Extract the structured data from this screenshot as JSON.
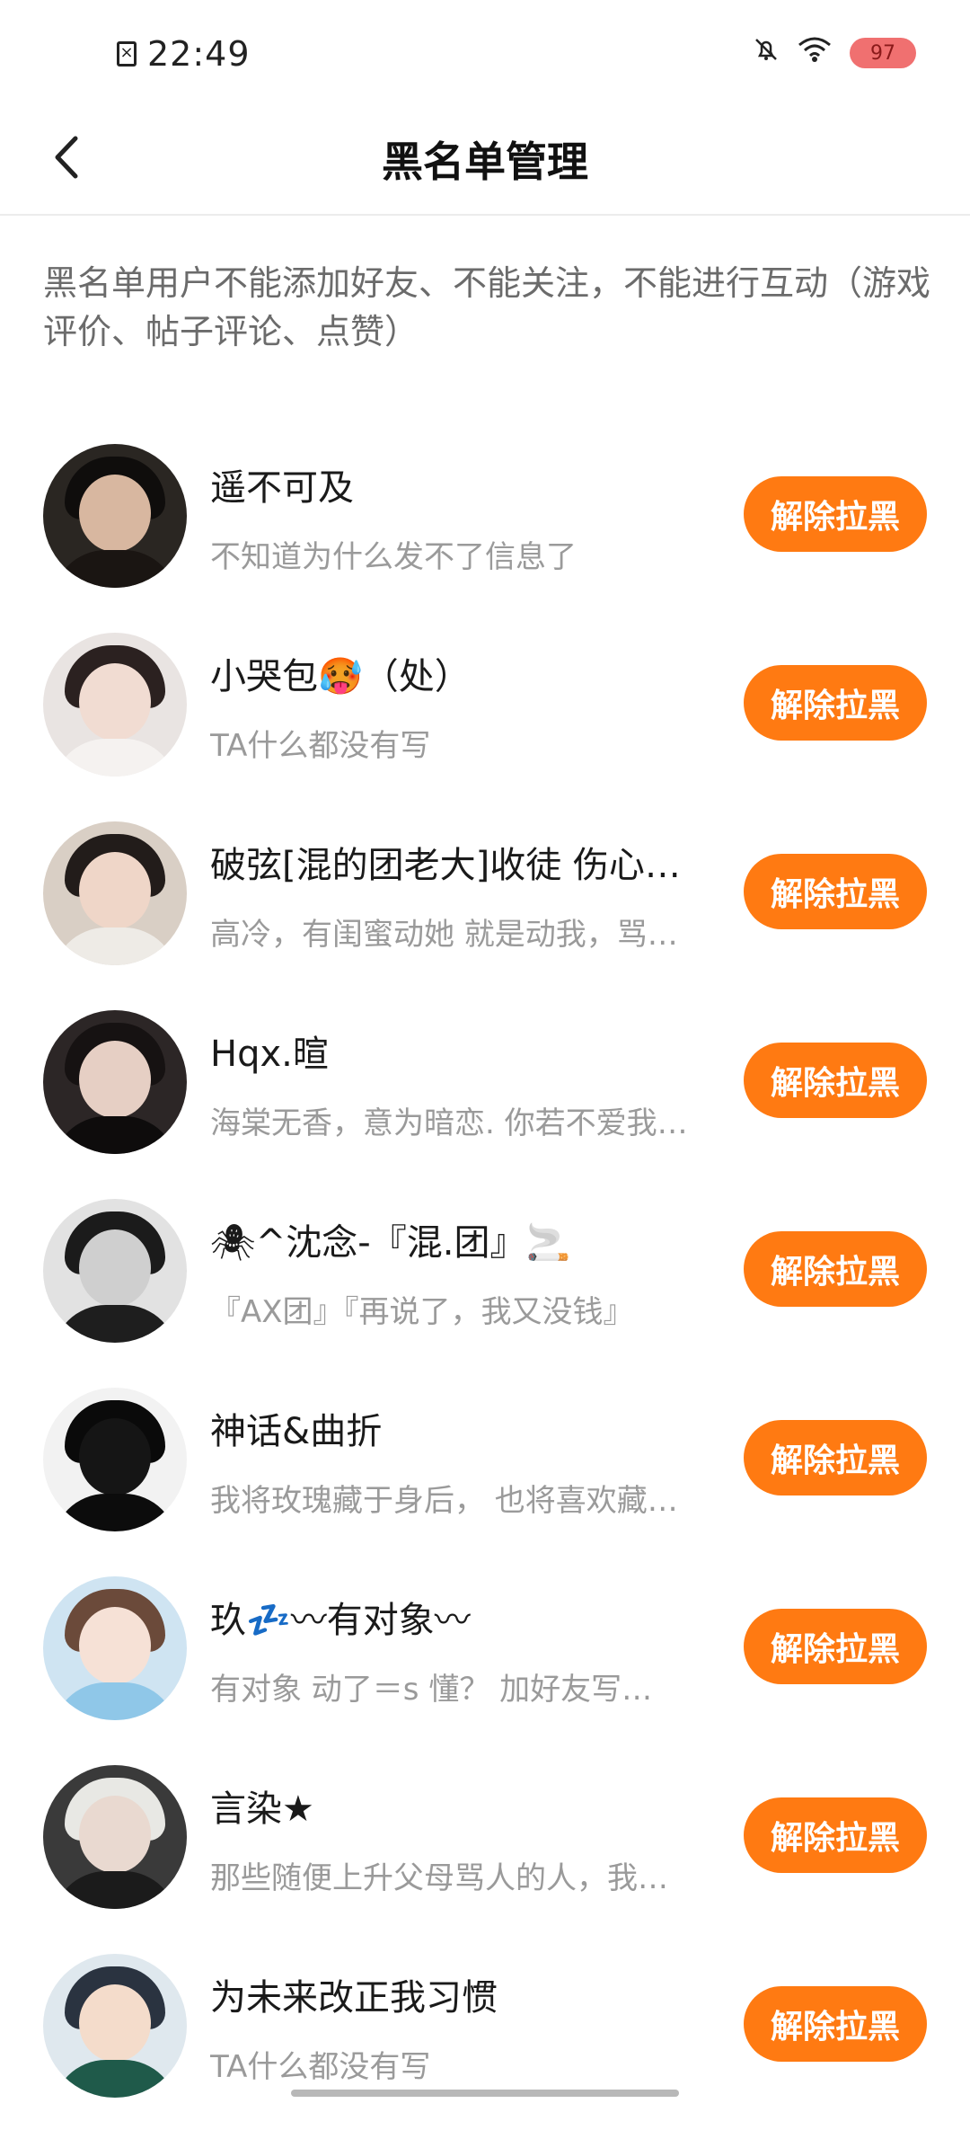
{
  "status_bar": {
    "time": "22:49",
    "battery": "97",
    "icons": [
      "sim-error-icon",
      "bell-off-icon",
      "wifi-icon",
      "battery-icon"
    ]
  },
  "header": {
    "title": "黑名单管理",
    "back_icon": "chevron-left-icon"
  },
  "notice": "黑名单用户不能添加好友、不能关注，不能进行互动（游戏评价、帖子评论、点赞）",
  "accent_color": "#ff7a12",
  "users": [
    {
      "name": "遥不可及",
      "bio": "不知道为什么发不了信息了",
      "button": "解除拉黑"
    },
    {
      "name": "小哭包🥵（处）",
      "bio": "TA什么都没有写",
      "button": "解除拉黑"
    },
    {
      "name": "破弦[混的团老大]收徒  伤心…",
      "bio": "高冷，有闺蜜动她  就是动我，骂…",
      "button": "解除拉黑"
    },
    {
      "name": "Hqx.暄",
      "bio": "海棠无香，意为暗恋. 你若不爱我…",
      "button": "解除拉黑"
    },
    {
      "name": "🕷^沈念-『混.团』🚬",
      "bio": "『AX团』『再说了，我又没钱』",
      "button": "解除拉黑"
    },
    {
      "name": "神话&曲折",
      "bio": "我将玫瑰藏于身后，  也将喜欢藏…",
      "button": "解除拉黑"
    },
    {
      "name": "玖💤〰有对象〰",
      "bio": "有对象  动了＝s  懂？  加好友写…",
      "button": "解除拉黑"
    },
    {
      "name": "言染★",
      "bio": "那些随便上升父母骂人的人，我…",
      "button": "解除拉黑"
    },
    {
      "name": "为未来改正我习惯",
      "bio": "TA什么都没有写",
      "button": "解除拉黑"
    }
  ]
}
